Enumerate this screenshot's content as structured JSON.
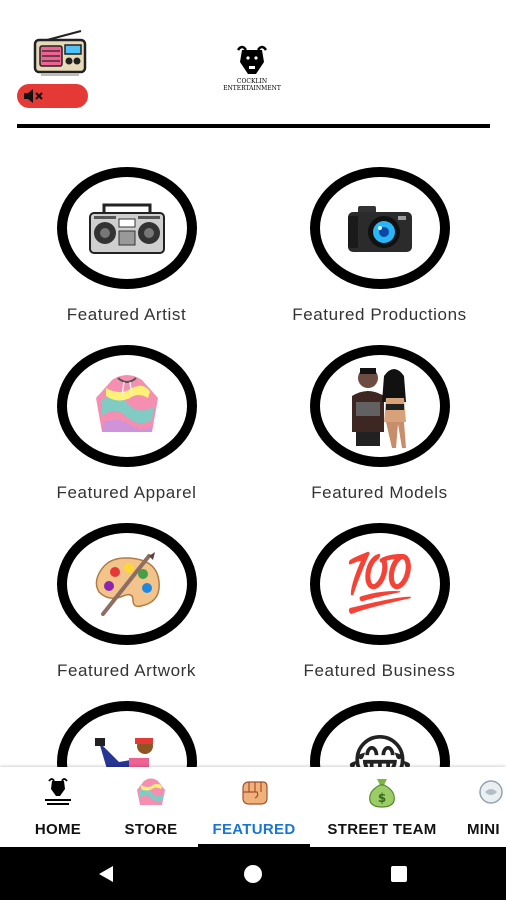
{
  "header": {
    "logo_text_line1": "COCKLIN",
    "logo_text_line2": "ENTERTAINMENT",
    "radio_icon": "radio-icon",
    "mute_icon": "speaker-mute-icon",
    "mute_color": "#e53935"
  },
  "grid": {
    "items": [
      {
        "label": "Featured Artist",
        "icon": "boombox-icon"
      },
      {
        "label": "Featured Productions",
        "icon": "camera-icon"
      },
      {
        "label": "Featured Apparel",
        "icon": "tie-dye-hoodie-icon"
      },
      {
        "label": "Featured Models",
        "icon": "models-photo-icon"
      },
      {
        "label": "Featured Artwork",
        "icon": "artist-palette-icon"
      },
      {
        "label": "Featured Business",
        "icon": "hundred-points-icon",
        "glyph": "💯"
      },
      {
        "label": "",
        "icon": "reclining-person-icon"
      },
      {
        "label": "",
        "icon": "crying-laughing-face-icon",
        "glyph": "😂"
      }
    ]
  },
  "tabs": [
    {
      "label": "HOME",
      "icon": "bull-logo-icon",
      "active": false
    },
    {
      "label": "STORE",
      "icon": "hoodie-store-icon",
      "active": false
    },
    {
      "label": "FEATURED",
      "icon": "fist-icon",
      "active": true
    },
    {
      "label": "STREET TEAM",
      "icon": "money-bag-icon",
      "active": false
    },
    {
      "label": "MINI",
      "icon": "mini-icon",
      "active": false
    }
  ],
  "colors": {
    "active_tab": "#1976d2",
    "ring": "#000000",
    "nav_bar": "#000000"
  }
}
